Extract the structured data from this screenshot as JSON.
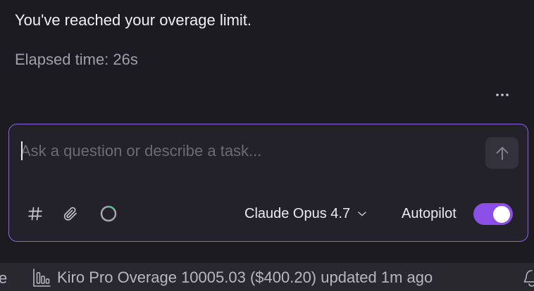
{
  "chat": {
    "message": "You've reached your overage limit.",
    "elapsed": "Elapsed time: 26s"
  },
  "composer": {
    "placeholder": "Ask a question or describe a task...",
    "value": "",
    "model": "Claude Opus 4.7",
    "autopilot_label": "Autopilot",
    "autopilot_on": true
  },
  "status_bar": {
    "prev_fragment": "e",
    "usage_text": "Kiro Pro Overage 10005.03 ($400.20) updated 1m ago"
  },
  "colors": {
    "background": "#1c1b22",
    "composer_border": "#8a63e0",
    "toggle_on": "#8b4fe8",
    "status_bar": "#29282f"
  },
  "icons": [
    "more-horizontal-icon",
    "arrow-up-icon",
    "hash-icon",
    "paperclip-icon",
    "progress-ring-icon",
    "chevron-down-icon",
    "bar-chart-icon",
    "bell-icon"
  ]
}
